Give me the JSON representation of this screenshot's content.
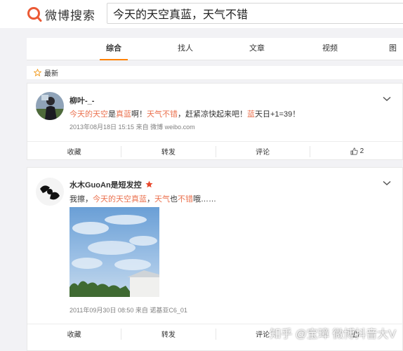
{
  "header": {
    "logo_text": "微博搜索",
    "search_value": "今天的天空真蓝，天气不错",
    "brand_color": "#eb5a35"
  },
  "tabs": [
    {
      "label": "综合",
      "active": true
    },
    {
      "label": "找人",
      "active": false
    },
    {
      "label": "文章",
      "active": false
    },
    {
      "label": "视频",
      "active": false
    },
    {
      "label": "图",
      "active": false
    }
  ],
  "filter": {
    "label": "最新"
  },
  "posts": [
    {
      "author": "柳叶-_-",
      "text_parts": [
        {
          "t": "今天的天空",
          "red": true
        },
        {
          "t": "是",
          "red": false
        },
        {
          "t": "真蓝",
          "red": true
        },
        {
          "t": "啊！",
          "red": false
        },
        {
          "t": "天气不错",
          "red": true
        },
        {
          "t": "，赶紧凉快起来吧！",
          "red": false
        },
        {
          "t": "蓝",
          "red": true
        },
        {
          "t": "天日+1=39！",
          "red": false
        }
      ],
      "meta": "2013年08月18日 15:15  来自 微博 weibo.com",
      "actions": {
        "collect": "收藏",
        "repost": "转发",
        "comment": "评论",
        "like_count": "2"
      }
    },
    {
      "author": "水木GuoAn是短发控",
      "text_parts": [
        {
          "t": "我擦，",
          "red": false
        },
        {
          "t": "今天的天空真蓝",
          "red": true
        },
        {
          "t": "，",
          "red": false
        },
        {
          "t": "天气",
          "red": true
        },
        {
          "t": "也",
          "red": false
        },
        {
          "t": "不错",
          "red": true
        },
        {
          "t": "哦……",
          "red": false
        }
      ],
      "meta": "2011年09月30日 08:50  来自 诺基亚C6_01",
      "actions": {
        "collect": "收藏",
        "repost": "转发",
        "comment": "评论"
      }
    }
  ],
  "watermark": "知乎 @宝璋 微博抖音大V",
  "colors": {
    "highlight": "#eb7350",
    "active_tab": "#ff8200",
    "badge_star": "#e8472b"
  }
}
